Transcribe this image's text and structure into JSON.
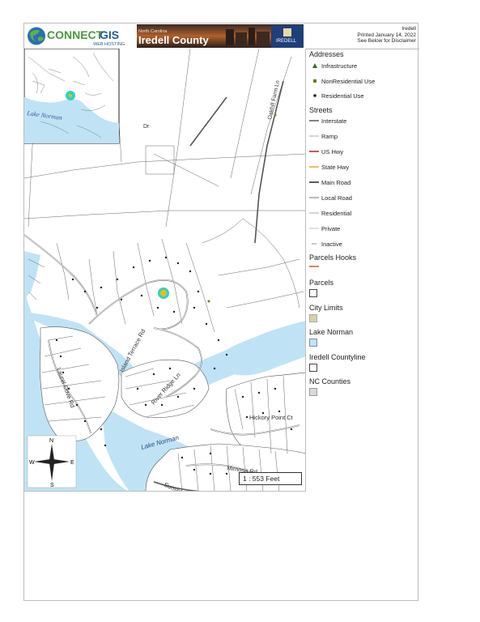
{
  "header": {
    "logo_text_connect": "CONNECT",
    "logo_text_gis": "GIS",
    "logo_subtext": "WEB HOSTING",
    "banner_state": "North Carolina",
    "banner_county": "Iredell County",
    "banner_seal_text": "IREDELL",
    "print_county": "Iredell",
    "print_date": "Printed January 14, 2022",
    "print_disclaimer": "See Below for Disclaimer"
  },
  "map": {
    "inset_label": "Lake Norman",
    "streets": {
      "laurel_cove": "Laurel Cove Rd",
      "island_terrace": "Island Terrace Rd",
      "river_ridge": "River Ridge Ln",
      "hickory_point": "Hickory Point Ct",
      "mimosa": "Mimosa Rd",
      "sunset_view": "Sunset View Ln",
      "oakhill_farm": "Oakhill Farm Ln",
      "dr_fragment": "Dr",
      "lake_norman": "Lake Norman"
    },
    "compass": {
      "n": "N",
      "s": "S",
      "e": "E",
      "w": "W"
    },
    "scale": "1 : 553 Feet"
  },
  "legend": {
    "addresses": {
      "title": "Addresses",
      "items": [
        "Infrastructure",
        "NonResidential Use",
        "Residential Use"
      ]
    },
    "streets": {
      "title": "Streets",
      "items": [
        "Interstate",
        "Ramp",
        "US Hwy",
        "State Hwy",
        "Main Road",
        "Local Road",
        "Residential",
        "Private",
        "Inactive"
      ]
    },
    "parcels_hooks": "Parcels Hooks",
    "parcels": "Parcels",
    "city_limits": "City Limits",
    "lake_norman": "Lake Norman",
    "iredell_countyline": "Iredell Countyline",
    "nc_counties": "NC Counties",
    "colors": {
      "water": "#bfe3f5",
      "us_hwy": "#a31515",
      "state_hwy": "#e8a020",
      "main_road": "#333333",
      "parcels_hooks": "#c0501f",
      "city_limits": "#d6d1a6",
      "nc_counties": "#d9d9d9",
      "highlight": "#2fd2c6",
      "subject": "#e8c010"
    }
  }
}
